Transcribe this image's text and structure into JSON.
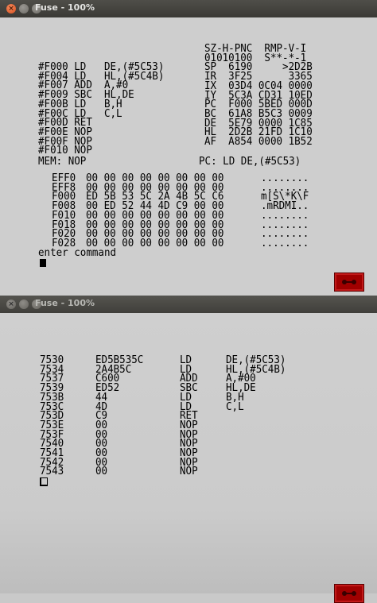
{
  "window_top": {
    "title": "Fuse - 100%",
    "controls": {
      "close": "×"
    },
    "disassembly": [
      "#F000 LD   DE,(#5C53)",
      "#F004 LD   HL,(#5C4B)",
      "#F007 ADD  A,#0",
      "#F009 SBC  HL,DE",
      "#F00B LD   B,H",
      "#F00C LD   C,L",
      "#F00D RET",
      "#F00E NOP",
      "#F00F NOP",
      "#F010 NOP"
    ],
    "registers_header": "SZ-H-PNC  RMP-V-I",
    "registers": [
      "01010100  S**-*-1",
      "SP  6190     >2D2B",
      "IR  3F25      3365",
      "IX  03D4 0C04 0000",
      "IY  5C3A CD31 10ED",
      "PC  F000 5BED 000D",
      "BC  61A8 B5C3 0009",
      "DE  5E79 0000 1C85",
      "HL  2D2B 21FD 1C10",
      "AF  A854 0000 1B52"
    ],
    "mem_label": "MEM: NOP",
    "pc_label": "PC: LD DE,(#5C53)",
    "hexdump": {
      "addresses": [
        "EFF0",
        "EFF8",
        "F000",
        "F008",
        "F010",
        "F018",
        "F020",
        "F028"
      ],
      "bytes": [
        "00 00 00 00 00 00 00 00",
        "00 00 00 00 00 00 00 00",
        "ED 5B 53 5C 2A 4B 5C C6",
        "00 ED 52 44 4D C9 00 00",
        "00 00 00 00 00 00 00 00",
        "00 00 00 00 00 00 00 00",
        "00 00 00 00 00 00 00 00",
        "00 00 00 00 00 00 00 00"
      ],
      "ascii": [
        "........",
        "........",
        "m[S\\*K\\F",
        ".mRDMI..",
        "........",
        "........",
        "........",
        "........"
      ]
    },
    "prompt": "enter command"
  },
  "window_bottom": {
    "title": "Fuse - 100%",
    "controls": {
      "close": "×"
    },
    "listing": {
      "addresses": [
        "7530",
        "7534",
        "7537",
        "7539",
        "753B",
        "753C",
        "753D",
        "753E",
        "753F",
        "7540",
        "7541",
        "7542",
        "7543"
      ],
      "bytes": [
        "ED5B535C",
        "2A4B5C",
        "C600",
        "ED52",
        "44",
        "4D",
        "C9",
        "00",
        "00",
        "00",
        "00",
        "00",
        "00"
      ],
      "mnemonics": [
        "LD",
        "LD",
        "ADD",
        "SBC",
        "LD",
        "LD",
        "RET",
        "NOP",
        "NOP",
        "NOP",
        "NOP",
        "NOP",
        "NOP"
      ],
      "operands": [
        "DE,(#5C53)",
        "HL,(#5C4B)",
        "A,#00",
        "HL,DE",
        "B,H",
        "C,L",
        "",
        "",
        "",
        "",
        "",
        "",
        ""
      ]
    }
  },
  "colors": {
    "titlebar": "#3c3b37",
    "screen_bg": "#cdcdcd",
    "text": "#000000",
    "tape_icon": "#a00000"
  },
  "icons": {
    "tape_status": "cassette-tape-icon"
  }
}
